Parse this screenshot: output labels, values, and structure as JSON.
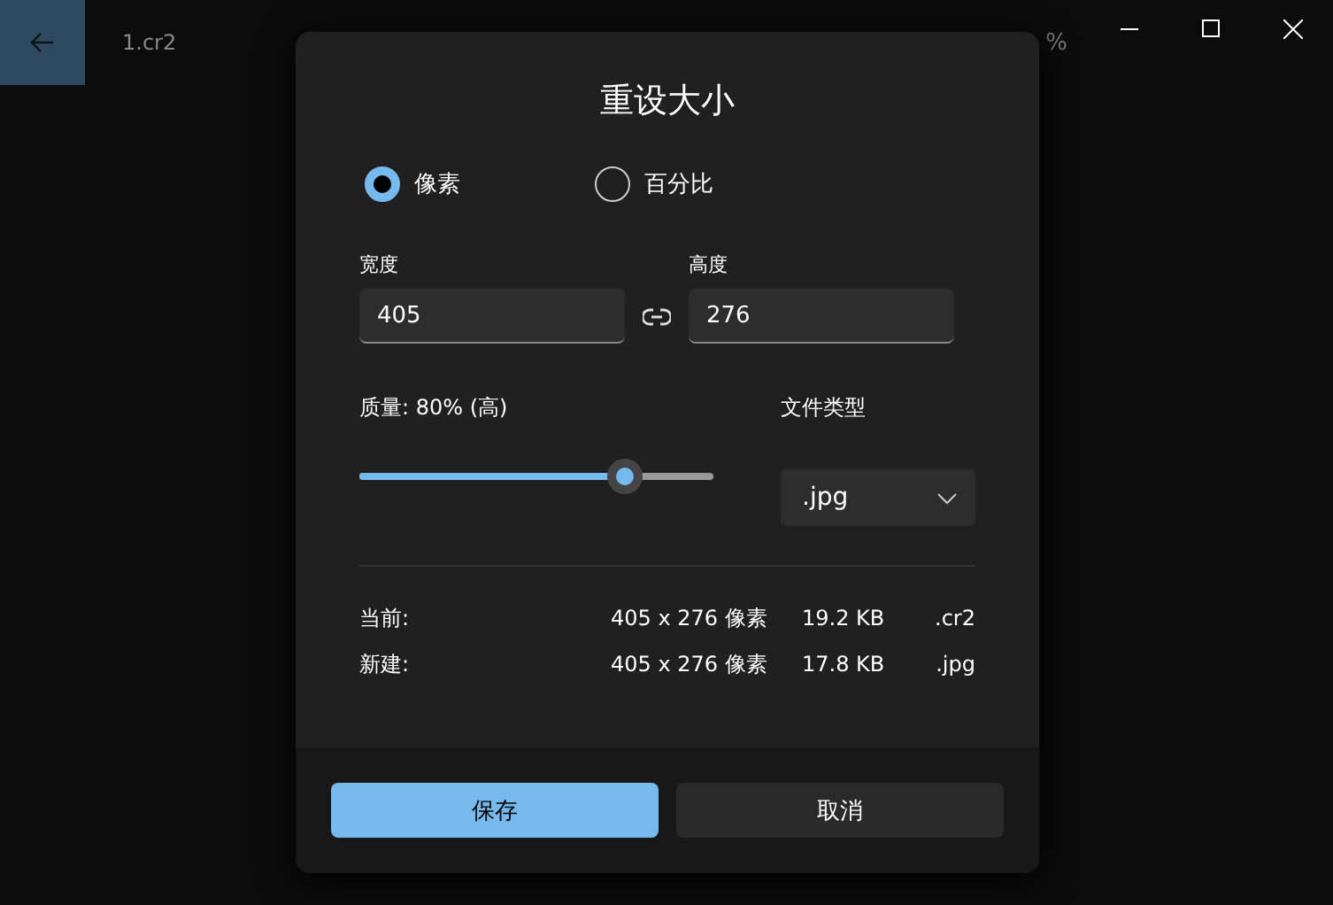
{
  "app": {
    "file_name": "1.cr2",
    "zoom_partial": "%"
  },
  "dialog": {
    "title": "重设大小",
    "modes": [
      {
        "label": "像素",
        "selected": true
      },
      {
        "label": "百分比",
        "selected": false
      }
    ],
    "width": {
      "label": "宽度",
      "value": "405"
    },
    "height": {
      "label": "高度",
      "value": "276"
    },
    "quality": {
      "label": "质量: 80% (高)",
      "level": 0.75
    },
    "file_type": {
      "label": "文件类型",
      "value": ".jpg"
    },
    "info_rows": [
      {
        "label": "当前:",
        "dimensions": "405 x 276 像素",
        "size": "19.2 KB",
        "ext": ".cr2"
      },
      {
        "label": "新建:",
        "dimensions": "405 x 276 像素",
        "size": "17.8 KB",
        "ext": ".jpg"
      }
    ],
    "buttons": [
      {
        "label": "保存",
        "kind": "primary"
      },
      {
        "label": "取消",
        "kind": "secondary"
      }
    ]
  }
}
